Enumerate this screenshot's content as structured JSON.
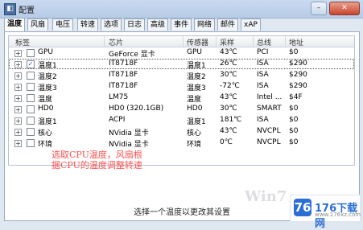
{
  "window": {
    "title": "配置",
    "app_icon_glyph": "◧"
  },
  "tabs": [
    "温度",
    "风扇",
    "电压",
    "转速",
    "选项",
    "日志",
    "高级",
    "事件",
    "网络",
    "邮件",
    "xAP"
  ],
  "columns": {
    "label": "标签",
    "chip": "芯片",
    "sensor": "传感器",
    "sample": "采样",
    "bus": "总线",
    "address": "地址"
  },
  "sensors": [
    {
      "label": "GPU",
      "chip": "GeForce 显卡",
      "sensor": "GPU",
      "sample": "43℃",
      "bus": "PCI",
      "address": "$0",
      "checked": false
    },
    {
      "label": "温度1",
      "chip": "IT8718F",
      "sensor": "温度1",
      "sample": "26℃",
      "bus": "ISA",
      "address": "$290",
      "checked": true,
      "selected": true
    },
    {
      "label": "温度2",
      "chip": "IT8718F",
      "sensor": "温度2",
      "sample": "30℃",
      "bus": "ISA",
      "address": "$290",
      "checked": false
    },
    {
      "label": "温度3",
      "chip": "IT8718F",
      "sensor": "温度3",
      "sample": "-72℃",
      "bus": "ISA",
      "address": "$290",
      "checked": false
    },
    {
      "label": "温度",
      "chip": "LM75",
      "sensor": "温度",
      "sample": "43℃",
      "bus": "Intel ...",
      "address": "$4F",
      "checked": false
    },
    {
      "label": "HD0",
      "chip": "HD0 (320.1GB)",
      "sensor": "HD0",
      "sample": "30℃",
      "bus": "SMART",
      "address": "$0",
      "checked": false
    },
    {
      "label": "温度1",
      "chip": "ACPI",
      "sensor": "温度1",
      "sample": "181℃",
      "bus": "ISA",
      "address": "$0",
      "checked": false
    },
    {
      "label": "核心",
      "chip": "NVidia 显卡",
      "sensor": "核心",
      "sample": "43℃",
      "bus": "NVCPL",
      "address": "$0",
      "checked": false
    },
    {
      "label": "环境",
      "chip": "NVidia 显卡",
      "sensor": "环境",
      "sample": "0℃",
      "bus": "NVCPL",
      "address": "$0",
      "checked": false
    }
  ],
  "annotation": "选取CPU温度，风扇根据CPU的温度调整转速",
  "status": "选择一个温度以更改其设置",
  "watermark": {
    "win_text": "Win7",
    "brand_name": "176下载网",
    "brand_icon": "76",
    "brand_sub": "www.176xz.com"
  },
  "icons": {
    "expander": "+",
    "check": "✓",
    "minimize": "–",
    "close": "✕"
  }
}
